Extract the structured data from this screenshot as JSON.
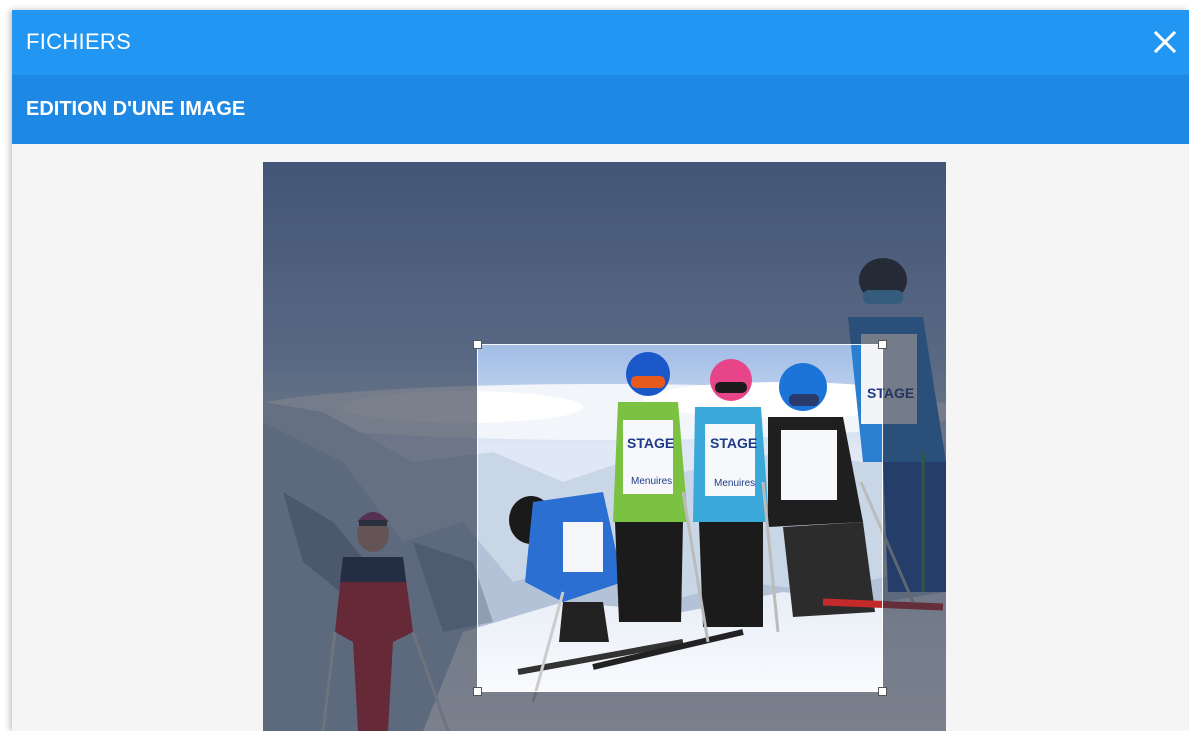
{
  "window": {
    "title": "FICHIERS",
    "close_icon": "close-icon"
  },
  "editor": {
    "heading": "EDITION D'UNE IMAGE"
  },
  "photo": {
    "bib_text": "STAGE",
    "bib_resort": "Menuires",
    "crop_handles": [
      "top-left",
      "top-right",
      "bottom-left",
      "bottom-right"
    ]
  },
  "colors": {
    "header": "#2196f3",
    "subheader": "#1e88e5",
    "background": "#f5f5f6"
  }
}
